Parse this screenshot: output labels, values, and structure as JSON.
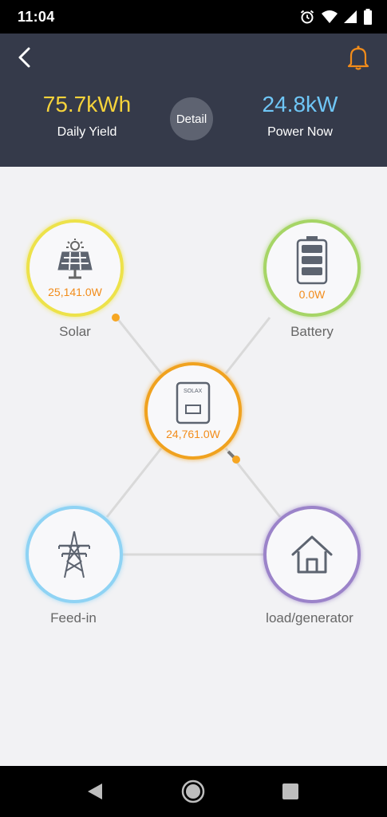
{
  "status_bar": {
    "time": "11:04",
    "icons": [
      "alarm-icon",
      "wifi-icon",
      "signal-icon",
      "battery-icon"
    ]
  },
  "header": {
    "daily_yield": {
      "value": "75.7kWh",
      "label": "Daily Yield"
    },
    "power_now": {
      "value": "24.8kW",
      "label": "Power Now"
    },
    "detail_label": "Detail",
    "colors": {
      "background": "#353a4a",
      "yield": "#f6d33b",
      "power": "#6fc6f6",
      "bell": "#f28c1a"
    }
  },
  "flow": {
    "solar": {
      "label": "Solar",
      "value": "25,141.0W",
      "color": "#ede24a"
    },
    "battery": {
      "label": "Battery",
      "value": "0.0W",
      "color": "#a6d566"
    },
    "inverter": {
      "value": "24,761.0W",
      "brand": "SOLAX",
      "color": "#f0a21f"
    },
    "feed_in": {
      "label": "Feed-in",
      "color": "#8fd3f4"
    },
    "load": {
      "label": "load/generator",
      "color": "#9b83c9"
    }
  },
  "nav_bar": {
    "buttons": [
      "back-triangle-icon",
      "home-circle-icon",
      "recents-square-icon"
    ]
  }
}
